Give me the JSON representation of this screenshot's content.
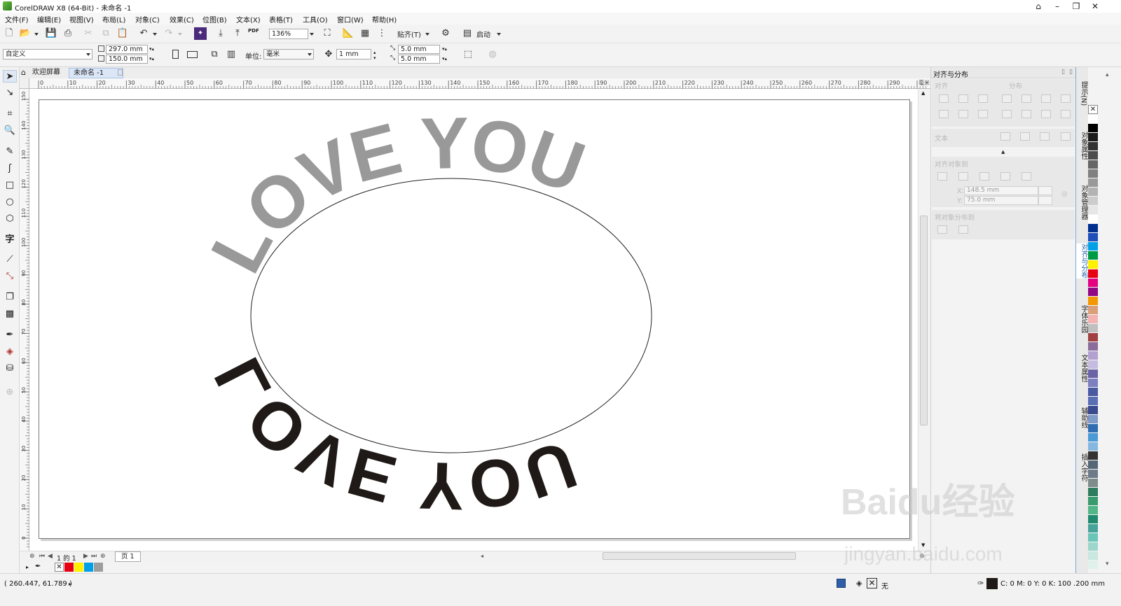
{
  "window": {
    "title": "CorelDRAW X8 (64-Bit) - 未命名 -1",
    "controls": [
      "⌂",
      "–",
      "❐",
      "✕"
    ]
  },
  "menu": [
    "文件(F)",
    "编辑(E)",
    "视图(V)",
    "布局(L)",
    "对象(C)",
    "效果(C)",
    "位图(B)",
    "文本(X)",
    "表格(T)",
    "工具(O)",
    "窗口(W)",
    "帮助(H)"
  ],
  "toolbar1": {
    "zoom": "136%",
    "snap_label": "贴齐(T)",
    "launch_label": "启动",
    "pdf_label": "PDF"
  },
  "toolbar2": {
    "preset": "自定义",
    "width": "297.0 mm",
    "height": "150.0 mm",
    "units_label": "单位:",
    "units_value": "毫米",
    "nudge": "1 mm",
    "dup_x": "5.0 mm",
    "dup_y": "5.0 mm"
  },
  "doc_tabs": [
    "欢迎屏幕",
    "未命名 -1"
  ],
  "hruler_ticks": [
    "0",
    "10",
    "20",
    "30",
    "40",
    "50",
    "60",
    "70",
    "80",
    "90",
    "100",
    "110",
    "120",
    "130",
    "140",
    "150",
    "160",
    "170",
    "180",
    "190",
    "200",
    "210",
    "220",
    "230",
    "240",
    "250",
    "260",
    "270",
    "280",
    "290",
    "毫米"
  ],
  "vruler_ticks": [
    "150",
    "140",
    "130",
    "120",
    "110",
    "100",
    "90",
    "80",
    "70",
    "60",
    "50",
    "40",
    "30",
    "20",
    "10",
    "0"
  ],
  "artwork": {
    "top_text": "LOVE YOU",
    "bottom_text": "LOVE YOU",
    "top_color": "#999999",
    "bottom_color": "#1f1a17",
    "ellipse_stroke": "#222222"
  },
  "page_nav": {
    "counter": "1 的 1",
    "page_tab": "页 1"
  },
  "docker": {
    "title": "对齐与分布",
    "align_label": "对齐",
    "distribute_label": "分布",
    "text_label": "文本",
    "align_to_label": "对齐对象到",
    "x_label": "X:",
    "x_value": "148.5 mm",
    "y_label": "Y:",
    "y_value": "75.0 mm",
    "distribute_to_label": "将对象分布到"
  },
  "side_tabs": [
    "提示(N)",
    "对象属性",
    "对象管理器",
    "对齐与分布",
    "字体乐园",
    "文本属性",
    "辅助线",
    "插入字符"
  ],
  "palette": [
    "#ffffff",
    "#000000",
    "#1a1a1a",
    "#333333",
    "#4d4d4d",
    "#666666",
    "#808080",
    "#999999",
    "#b3b3b3",
    "#cccccc",
    "#e6e6e6",
    "#ffffff",
    "#002f8f",
    "#1f4fb8",
    "#00a0e9",
    "#009944",
    "#fff100",
    "#e60012",
    "#e4007f",
    "#920783",
    "#f39800",
    "#d9a07a",
    "#f5b2b2",
    "#c0c0c0",
    "#a04040",
    "#8a6d9b",
    "#b4a0d0",
    "#c5bce0",
    "#6a64a6",
    "#7d80c0",
    "#4a5aa0",
    "#5a6eb4",
    "#3a4a90",
    "#7e9bc9",
    "#2d6db0",
    "#4b9ad6",
    "#84b8e0",
    "#333333",
    "#556677",
    "#6c7a89",
    "#7f8c8d",
    "#2e7d60",
    "#3a9a70",
    "#52b788",
    "#1f8a70",
    "#46a39b",
    "#6bc4b8",
    "#9dd6cc",
    "#c8e8e0",
    "#e0f0ea"
  ],
  "status": {
    "coords": "( 260.447, 61.789 )",
    "fill_none": "无",
    "outline": "C: 0 M: 0 Y: 0 K: 100  .200 mm"
  },
  "watermark": {
    "main": "Baidu经验",
    "sub": "jingyan.baidu.com"
  }
}
